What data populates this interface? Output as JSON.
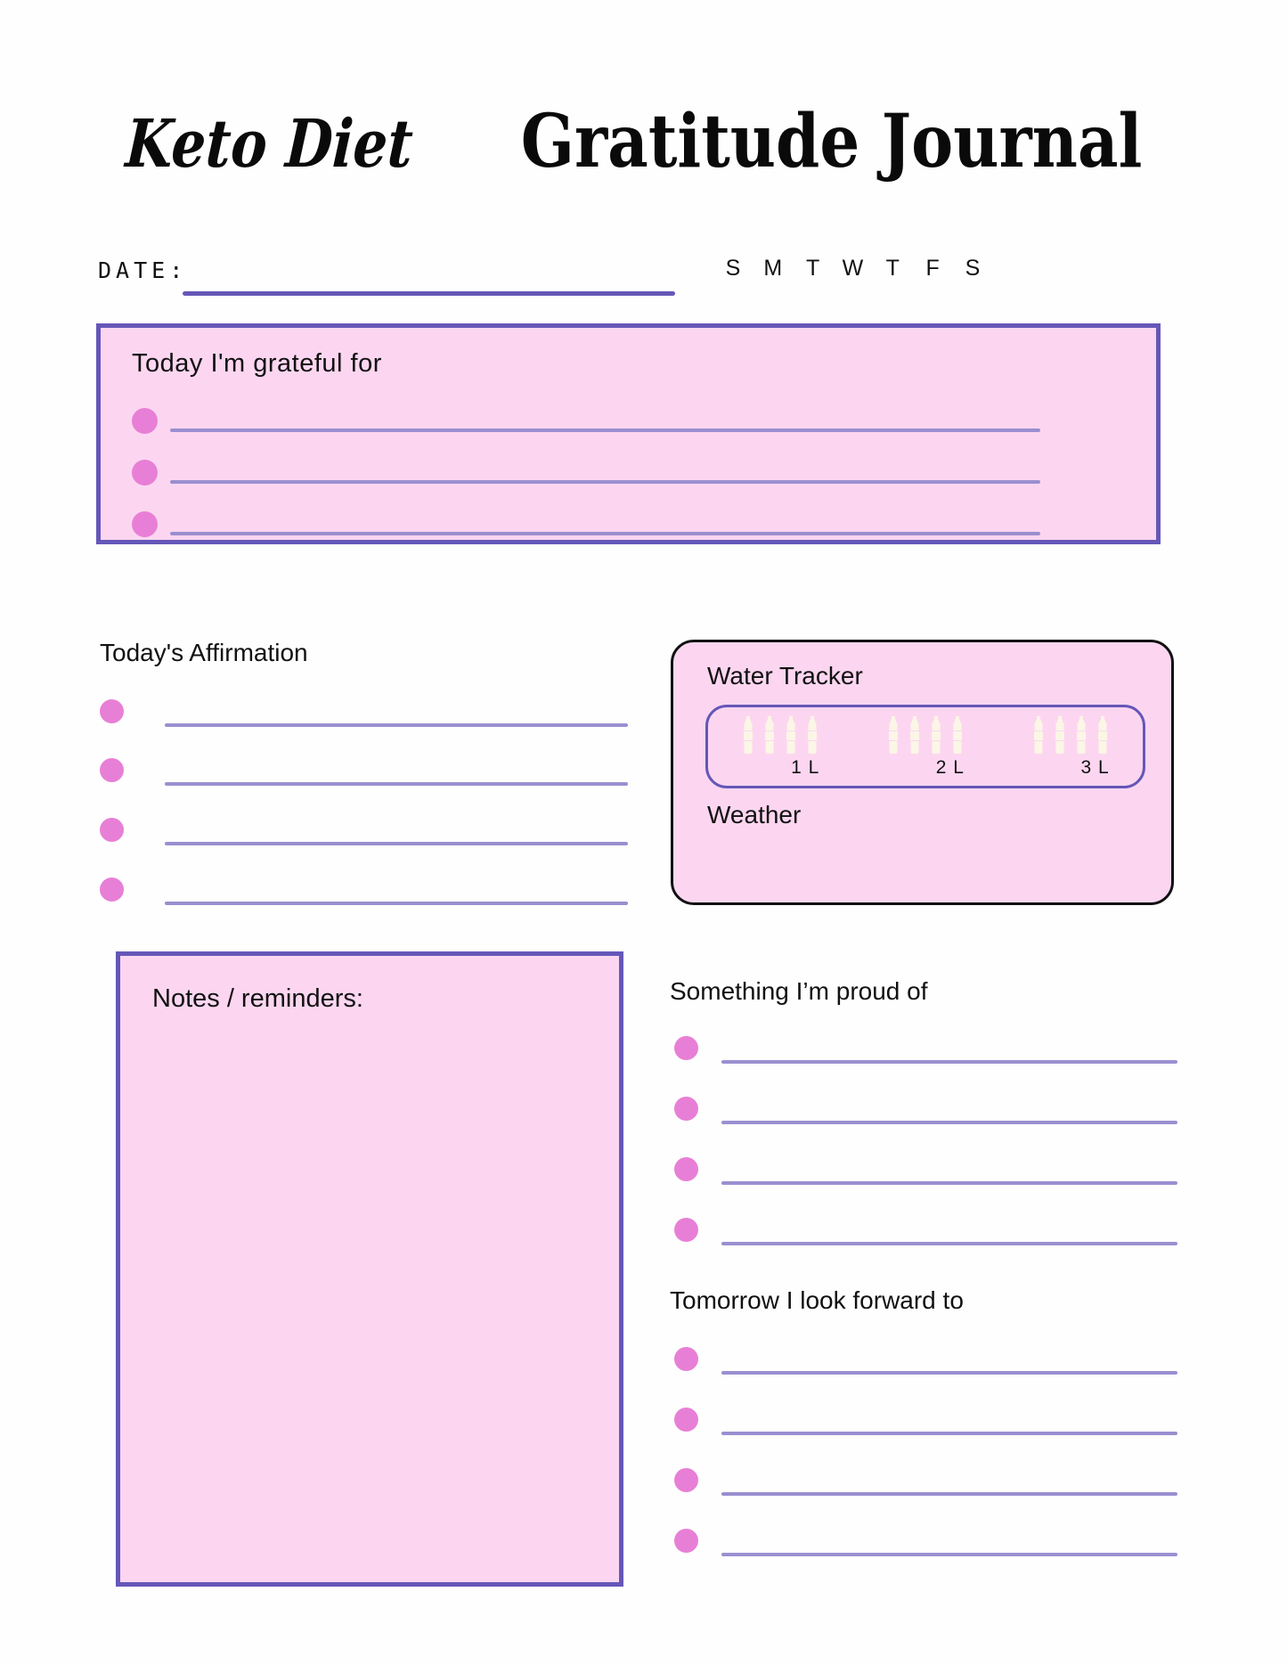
{
  "title": {
    "script_part": "Keto Diet",
    "serif_part": "Gratitude Journal"
  },
  "date": {
    "label": "DATE:",
    "value": "",
    "weekdays": [
      "S",
      "M",
      "T",
      "W",
      "T",
      "F",
      "S"
    ]
  },
  "grateful": {
    "heading": "Today I'm grateful for",
    "lines": [
      "",
      "",
      ""
    ]
  },
  "affirmation": {
    "heading": "Today's Affirmation",
    "lines": [
      "",
      "",
      "",
      ""
    ]
  },
  "water_tracker": {
    "heading": "Water Tracker",
    "groups": [
      {
        "label": "1 L",
        "bottles": 4
      },
      {
        "label": "2 L",
        "bottles": 4
      },
      {
        "label": "3 L",
        "bottles": 4
      }
    ]
  },
  "weather": {
    "heading": "Weather",
    "value": ""
  },
  "notes": {
    "heading": "Notes / reminders:",
    "value": ""
  },
  "proud": {
    "heading": "Something I’m proud of",
    "lines": [
      "",
      "",
      "",
      ""
    ]
  },
  "tomorrow": {
    "heading": "Tomorrow I look forward to",
    "lines": [
      "",
      "",
      "",
      ""
    ]
  },
  "colors": {
    "page_background": "#fefefe",
    "box_fill": "#fcd6f0",
    "box_border": "#6557b8",
    "bullet": "#e87fd6",
    "write_line": "#9a8fd0",
    "card_border": "#111111",
    "bottle": "#fbf6e6",
    "text": "#111111"
  }
}
